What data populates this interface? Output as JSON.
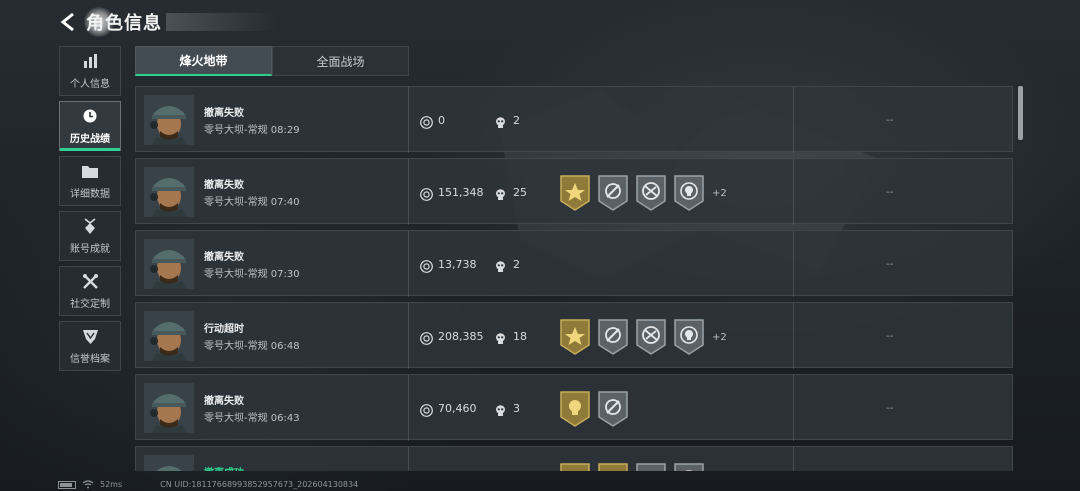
{
  "header": {
    "title": "角色信息"
  },
  "sidebar": {
    "items": [
      {
        "label": "个人信息",
        "icon": "bar-chart-icon",
        "active": false
      },
      {
        "label": "历史战绩",
        "icon": "clock-icon",
        "active": true
      },
      {
        "label": "详细数据",
        "icon": "folder-icon",
        "active": false
      },
      {
        "label": "账号成就",
        "icon": "medal-icon",
        "active": false
      },
      {
        "label": "社交定制",
        "icon": "tools-icon",
        "active": false
      },
      {
        "label": "信誉档案",
        "icon": "shield-icon",
        "active": false
      }
    ]
  },
  "tabs": [
    {
      "label": "烽火地带",
      "active": true
    },
    {
      "label": "全面战场",
      "active": false
    }
  ],
  "rows": [
    {
      "result": "撤离失败",
      "success": false,
      "map": "零号大坝-常规 08:29",
      "coins": "0",
      "kills": "2",
      "badges": [],
      "more": "",
      "rating": "--"
    },
    {
      "result": "撤离失败",
      "success": false,
      "map": "零号大坝-常规 07:40",
      "coins": "151,348",
      "kills": "25",
      "badges": [
        "gold-star-badge-icon",
        "crosshair-badge-icon",
        "no-gun-badge-icon",
        "skull-badge-icon"
      ],
      "more": "+2",
      "rating": "--"
    },
    {
      "result": "撤离失败",
      "success": false,
      "map": "零号大坝-常规 07:30",
      "coins": "13,738",
      "kills": "2",
      "badges": [],
      "more": "",
      "rating": "--"
    },
    {
      "result": "行动超时",
      "success": false,
      "map": "零号大坝-常规 06:48",
      "coins": "208,385",
      "kills": "18",
      "badges": [
        "gold-star-badge-icon",
        "crosshair-badge-icon",
        "no-gun-badge-icon",
        "skull-badge-icon"
      ],
      "more": "+2",
      "rating": "--"
    },
    {
      "result": "撤离失败",
      "success": false,
      "map": "零号大坝-常规 06:43",
      "coins": "70,460",
      "kills": "3",
      "badges": [
        "gold-skull-badge-icon",
        "crosshair-badge-icon"
      ],
      "more": "",
      "rating": "--"
    },
    {
      "result": "撤离成功",
      "success": true,
      "map": "",
      "coins": "",
      "kills": "",
      "badges": [
        "gold-star-badge-icon",
        "gold-star-badge-icon",
        "crosshair-badge-icon",
        "skull-badge-icon"
      ],
      "more": "",
      "rating": ""
    }
  ],
  "footer": {
    "ping": "52ms",
    "uid": "CN UID:18117668993852957673_202604130834"
  },
  "colors": {
    "accent": "#2fcf8f",
    "gold_badge": "#b89b45",
    "grey_badge": "#6f777d"
  }
}
